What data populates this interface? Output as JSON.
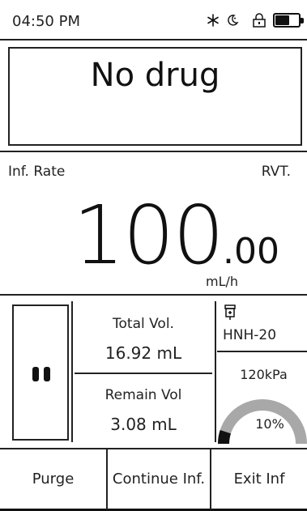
{
  "status_bar": {
    "time": "04:50 PM",
    "icons": [
      "snowflake-icon",
      "night-mode-icon",
      "lock-icon",
      "battery-icon"
    ],
    "battery_level": 0.6
  },
  "drug": {
    "name": "No drug"
  },
  "rate": {
    "label": "Inf. Rate",
    "mode": "RVT.",
    "integer": "100",
    "decimal": ".00",
    "unit": "mL/h"
  },
  "volumes": {
    "total_label": "Total Vol.",
    "total_value": "16.92 mL",
    "remain_label": "Remain Vol",
    "remain_value": "3.08 mL"
  },
  "pressure": {
    "syringe_model": "HNH-20",
    "value": "120kPa",
    "percent": "10%",
    "level": 0.1
  },
  "buttons": {
    "purge": "Purge",
    "continue": "Continue Inf.",
    "exit": "Exit Inf"
  },
  "colors": {
    "text": "#222222",
    "gauge_track": "#a8a8a8",
    "gauge_fill": "#111111"
  }
}
